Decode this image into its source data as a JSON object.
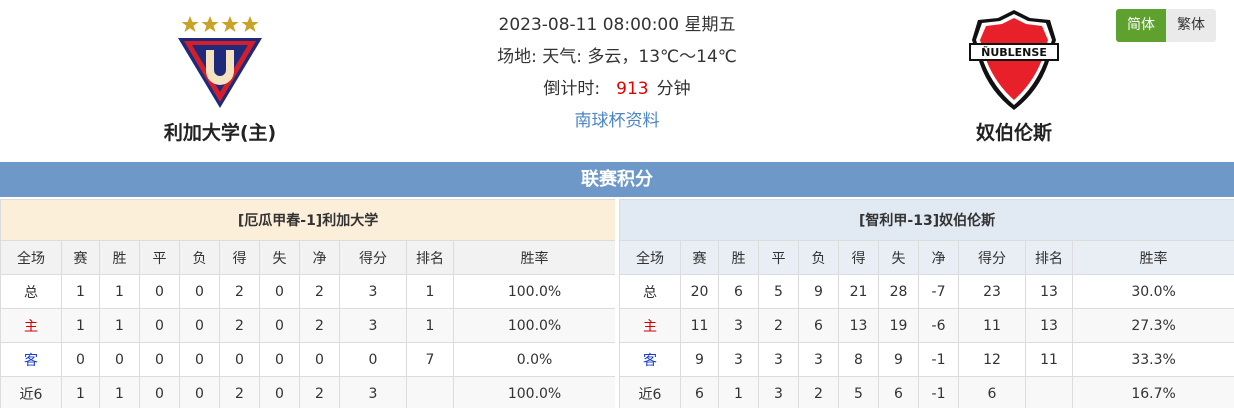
{
  "match": {
    "datetime": "2023-08-11 08:00:00 星期五",
    "venue_weather": "场地:   天气: 多云，13℃～14℃",
    "countdown_label": "倒计时:",
    "countdown_value": "913",
    "countdown_unit": "分钟",
    "cup_link": "南球杯资料"
  },
  "home_team": {
    "name": "利加大学(主)"
  },
  "away_team": {
    "name": "奴伯伦斯",
    "logo_text": "ÑUBLENSE"
  },
  "lang": {
    "simplified": "简体",
    "traditional": "繁体"
  },
  "section_title": "联赛积分",
  "colors": {
    "accent_red": "#e00000",
    "header_blue": "#6d98c8",
    "lang_green": "#5fa12f"
  },
  "headers": [
    "全场",
    "赛",
    "胜",
    "平",
    "负",
    "得",
    "失",
    "净",
    "得分",
    "排名",
    "胜率"
  ],
  "home_table": {
    "caption": "[厄瓜甲春-1]利加大学",
    "rows": [
      [
        "总",
        "1",
        "1",
        "0",
        "0",
        "2",
        "0",
        "2",
        "3",
        "1",
        "100.0%"
      ],
      [
        "主",
        "1",
        "1",
        "0",
        "0",
        "2",
        "0",
        "2",
        "3",
        "1",
        "100.0%"
      ],
      [
        "客",
        "0",
        "0",
        "0",
        "0",
        "0",
        "0",
        "0",
        "0",
        "7",
        "0.0%"
      ],
      [
        "近6",
        "1",
        "1",
        "0",
        "0",
        "2",
        "0",
        "2",
        "3",
        "",
        "100.0%"
      ]
    ]
  },
  "away_table": {
    "caption": "[智利甲-13]奴伯伦斯",
    "rows": [
      [
        "总",
        "20",
        "6",
        "5",
        "9",
        "21",
        "28",
        "-7",
        "23",
        "13",
        "30.0%"
      ],
      [
        "主",
        "11",
        "3",
        "2",
        "6",
        "13",
        "19",
        "-6",
        "11",
        "13",
        "27.3%"
      ],
      [
        "客",
        "9",
        "3",
        "3",
        "3",
        "8",
        "9",
        "-1",
        "12",
        "11",
        "33.3%"
      ],
      [
        "近6",
        "6",
        "1",
        "3",
        "2",
        "5",
        "6",
        "-1",
        "6",
        "",
        "16.7%"
      ]
    ]
  }
}
